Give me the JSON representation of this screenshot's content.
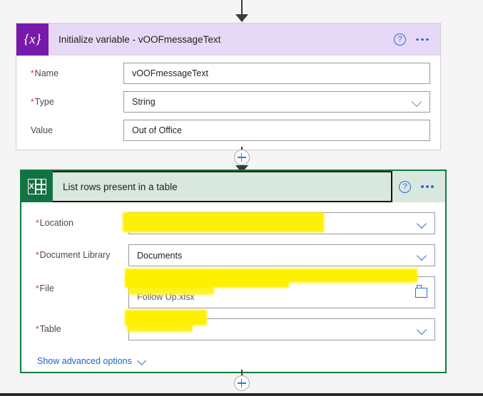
{
  "flow": {
    "top_connector": {
      "icon": "arrow-down-icon"
    },
    "middle_connector": {
      "add_label": "+",
      "icon": "plus-circle-icon"
    },
    "bottom_connector": {
      "add_label": "+",
      "icon": "plus-circle-icon"
    }
  },
  "cards": [
    {
      "id": "initialize-variable",
      "icon": "variable-braces-icon",
      "icon_glyph": "{x}",
      "title": "Initialize variable - vOOFmessageText",
      "header_bg": "#e6d9f5",
      "icon_bg": "#7719aa",
      "help_icon": "help-circle-icon",
      "menu_icon": "more-options-icon",
      "selected": false,
      "fields": [
        {
          "label": "Name",
          "required": true,
          "value": "vOOFmessageText",
          "control": "text",
          "redacted": false
        },
        {
          "label": "Type",
          "required": true,
          "value": "String",
          "control": "dropdown",
          "redacted": false
        },
        {
          "label": "Value",
          "required": false,
          "value": "Out of Office",
          "control": "text",
          "redacted": false
        }
      ]
    },
    {
      "id": "list-rows-present-in-a-table",
      "icon": "excel-icon",
      "title": "List rows present in a table",
      "header_bg": "#d8e8df",
      "icon_bg": "#137244",
      "border_color": "#107c41",
      "help_icon": "help-circle-icon",
      "menu_icon": "more-options-icon",
      "selected": true,
      "fields": [
        {
          "label": "Location",
          "required": true,
          "value": "",
          "control": "dropdown",
          "redacted": true
        },
        {
          "label": "Document Library",
          "required": true,
          "value": "Documents",
          "control": "dropdown",
          "redacted": false
        },
        {
          "label": "File",
          "required": true,
          "value": "",
          "secondary_value": "Follow Up.xlsx",
          "control": "file-picker",
          "redacted": true
        },
        {
          "label": "Table",
          "required": true,
          "value": "",
          "control": "dropdown",
          "redacted": true
        }
      ],
      "advanced_link": "Show advanced options",
      "advanced_icon": "chevron-down-icon"
    }
  ],
  "colors": {
    "canvas_bg": "#f5f5f5",
    "accent_blue": "#2b6fd6",
    "link_blue": "#1866c0",
    "required_red": "#d93025",
    "highlight_yellow": "#fdf000",
    "excel_green": "#137244",
    "variable_purple": "#7719aa"
  }
}
